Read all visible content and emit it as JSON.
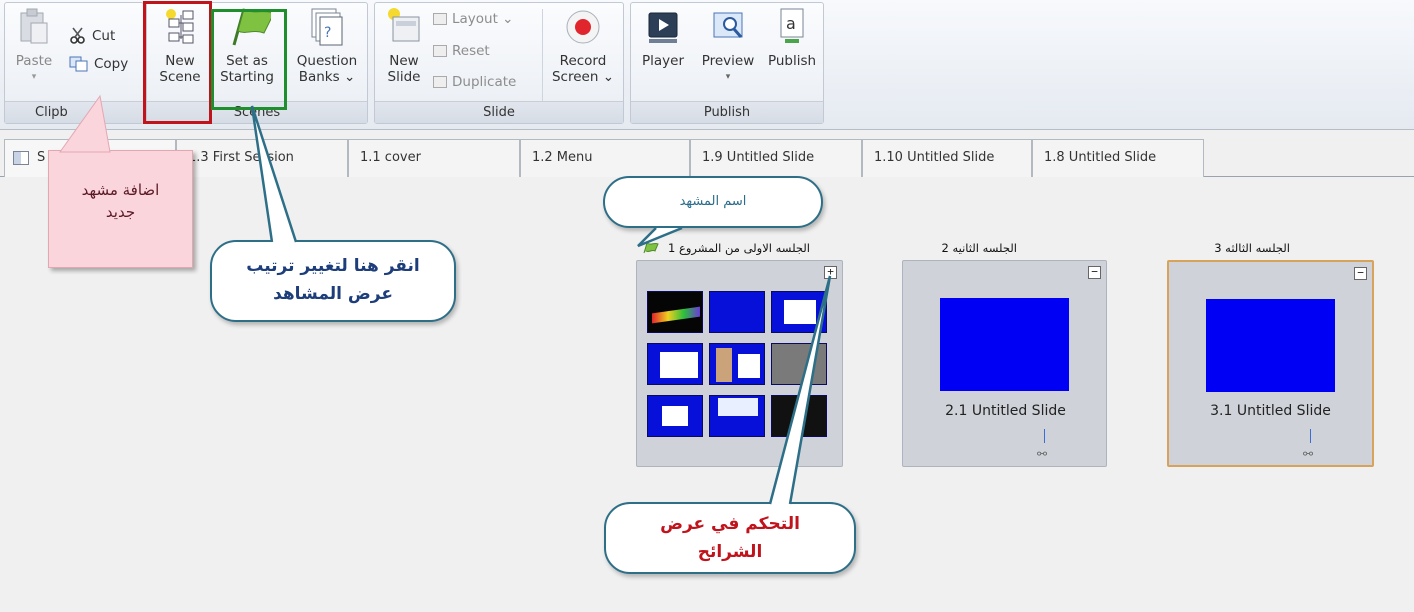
{
  "ribbon": {
    "clipboard": {
      "paste": "Paste",
      "cut": "Cut",
      "copy": "Copy",
      "label": "Clipb"
    },
    "scenes": {
      "new_scene": [
        "New",
        "Scene"
      ],
      "set_as_starting": [
        "Set as",
        "Starting"
      ],
      "question_banks": [
        "Question",
        "Banks ⌄"
      ],
      "label": "Scenes"
    },
    "slide": {
      "new_slide": [
        "New",
        "Slide"
      ],
      "layout": "Layout ⌄",
      "reset": "Reset",
      "duplicate": "Duplicate",
      "record_screen": [
        "Record",
        "Screen ⌄"
      ],
      "label": "Slide"
    },
    "publish": {
      "player": "Player",
      "preview": "Preview",
      "publish": "Publish",
      "label": "Publish"
    }
  },
  "tabs": [
    {
      "label": "S"
    },
    {
      "label": "1.3 First Session"
    },
    {
      "label": "1.1 cover"
    },
    {
      "label": "1.2 Menu"
    },
    {
      "label": "1.9 Untitled Slide"
    },
    {
      "label": "1.10 Untitled Slide"
    },
    {
      "label": "1.8 Untitled Slide"
    }
  ],
  "scenes": [
    {
      "title": "الجلسه الاولى من المشروع 1",
      "toggle": "+"
    },
    {
      "title": "الجلسه الثانيه 2",
      "toggle": "−",
      "slide_name": "2.1 Untitled Slide"
    },
    {
      "title": "الجلسه الثالثه 3",
      "toggle": "−",
      "slide_name": "3.1 Untitled Slide"
    }
  ],
  "annotations": {
    "new_scene_note": [
      "اضافة مشهد",
      "جديد"
    ],
    "scene_name_callout": "اسم المشهد",
    "starting_callout": [
      "انقر هنا لتغيير ترتيب",
      "عرض المشاهد"
    ],
    "slides_callout": [
      "التحكم في عرض",
      "الشرائح"
    ]
  },
  "colors": {
    "new_scene_highlight": "#c0131b",
    "set_as_starting_highlight": "#1e8f2c",
    "callout_border": "#2e6f88",
    "selected_scene_border": "#d7a35a",
    "slide_blue": "#0000f5"
  }
}
